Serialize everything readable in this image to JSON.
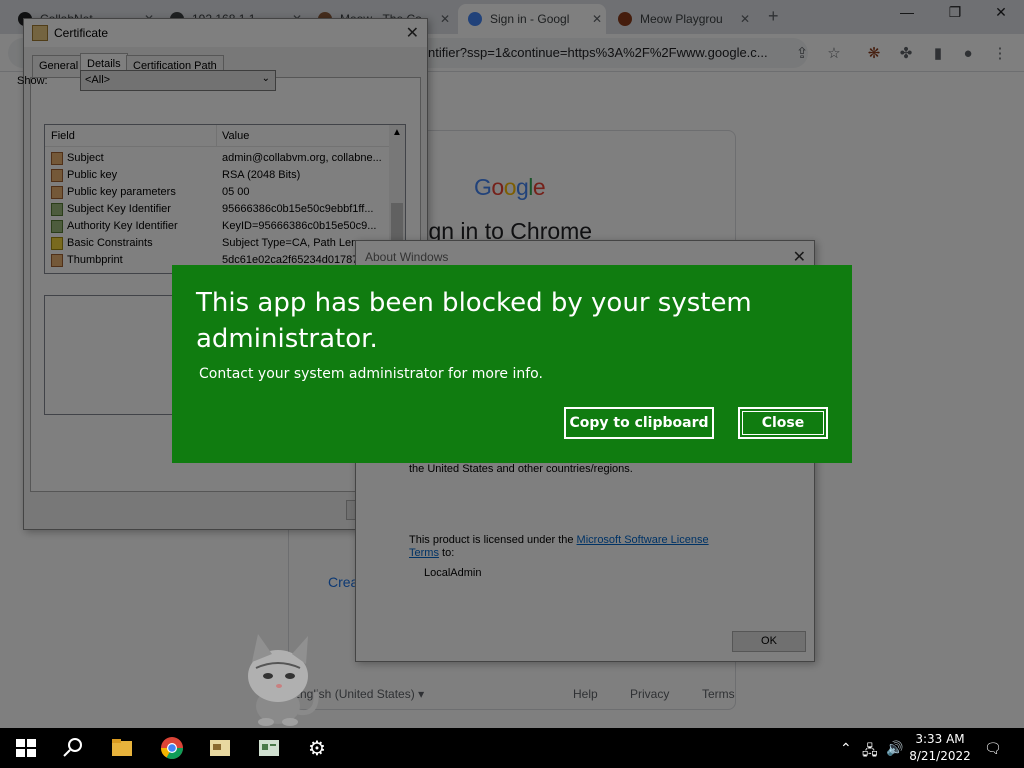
{
  "browser": {
    "tabs": [
      {
        "label": "CollabNet",
        "color": "#202124"
      },
      {
        "label": "192.168.1.1",
        "color": "#202124"
      },
      {
        "label": "Meow - The Co",
        "color": "#8a5a3a"
      },
      {
        "label": "Sign in - Googl",
        "color": "#4285f4"
      },
      {
        "label": "Meow Playgrou",
        "color": "#8a3a1a"
      }
    ],
    "new_tab": "+",
    "url": "ntifier?ssp=1&continue=https%3A%2F%2Fwww.google.c..."
  },
  "google_page": {
    "logo": "Google",
    "title": "Sign in to Chrome",
    "create_link": "Crea",
    "language": "English (United States)",
    "footer": {
      "help": "Help",
      "privacy": "Privacy",
      "terms": "Terms"
    }
  },
  "certificate": {
    "title": "Certificate",
    "tabs": [
      "General",
      "Details",
      "Certification Path"
    ],
    "show_label": "Show:",
    "show_value": "<All>",
    "columns": {
      "field": "Field",
      "value": "Value"
    },
    "rows": [
      {
        "field": "Subject",
        "value": "admin@collabvm.org, collabne..."
      },
      {
        "field": "Public key",
        "value": "RSA (2048 Bits)"
      },
      {
        "field": "Public key parameters",
        "value": "05 00"
      },
      {
        "field": "Subject Key Identifier",
        "value": "95666386c0b15e50c9ebbf1ff..."
      },
      {
        "field": "Authority Key Identifier",
        "value": "KeyID=95666386c0b15e50c9..."
      },
      {
        "field": "Basic Constraints",
        "value": "Subject Type=CA, Path Len"
      },
      {
        "field": "Thumbprint",
        "value": "5dc61e02ca2f65234d01787"
      }
    ]
  },
  "about_windows": {
    "title": "About Windows",
    "trademark_line": "the United States and other countries/regions.",
    "license_prefix": "This product is licensed under the",
    "license_link_1": "Microsoft Software License",
    "license_link_2": "Terms",
    "license_suffix": "to:",
    "licensee": "LocalAdmin",
    "ok": "OK"
  },
  "blocked_dialog": {
    "title": "This app has been blocked by your system administrator.",
    "message": "Contact your system administrator for more info.",
    "copy_button": "Copy to clipboard",
    "close_button": "Close",
    "accent": "#107c10"
  },
  "taskbar": {
    "time": "3:33 AM",
    "date": "8/21/2022"
  }
}
